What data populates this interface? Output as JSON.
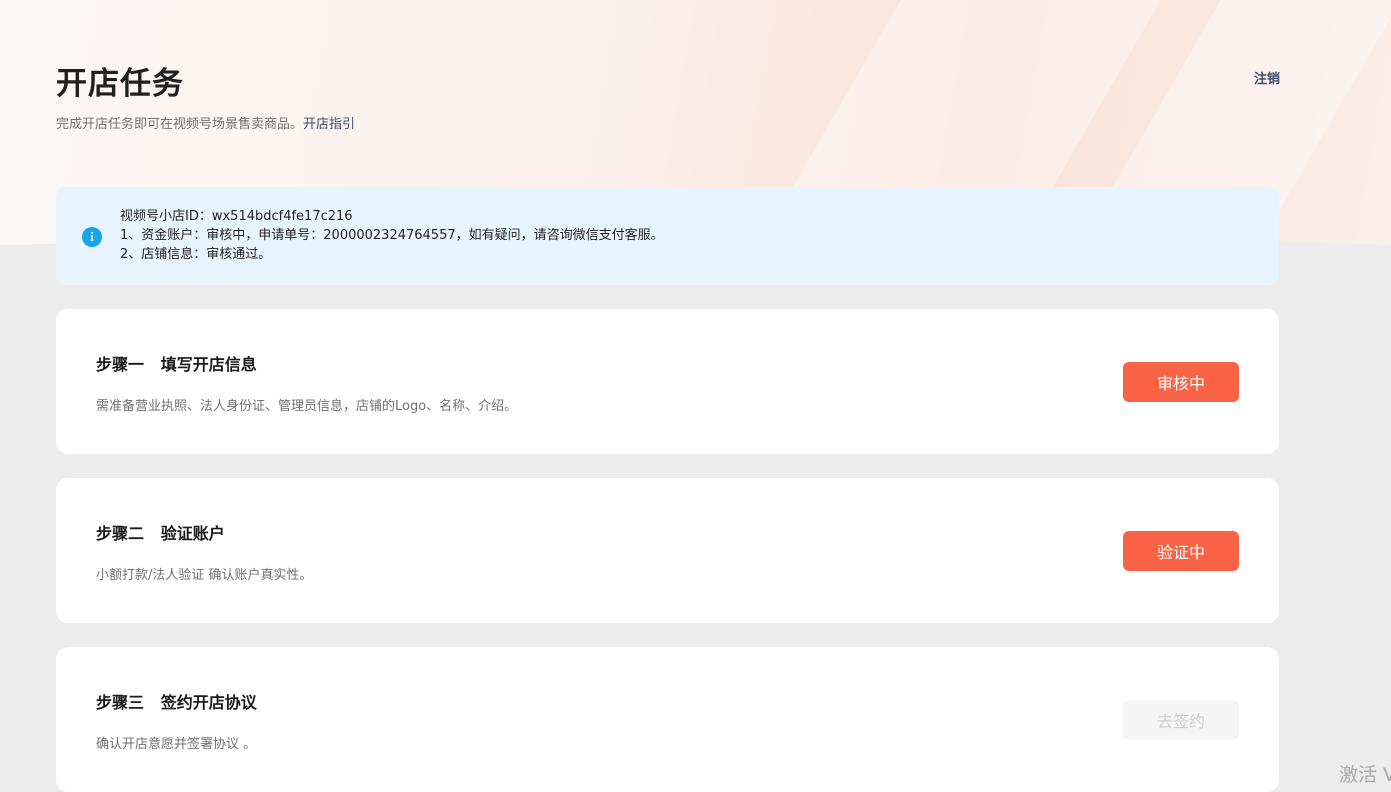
{
  "header": {
    "title": "开店任务",
    "subtitle": "完成开店任务即可在视频号场景售卖商品。",
    "guide_link": "开店指引",
    "logout": "注销"
  },
  "notice": {
    "icon": "info-icon",
    "icon_glyph": "i",
    "line1": "视频号小店ID：wx514bdcf4fe17c216",
    "line2": "1、资金账户：审核中，申请单号：2000002324764557，如有疑问，请咨询微信支付客服。",
    "line3": "2、店铺信息：审核通过。"
  },
  "steps": [
    {
      "title": "步骤一   填写开店信息",
      "desc": "需准备营业执照、法人身份证、管理员信息，店铺的Logo、名称、介绍。",
      "button": "审核中"
    },
    {
      "title": "步骤二   验证账户",
      "desc": "小额打款/法人验证 确认账户真实性。",
      "button": "验证中"
    },
    {
      "title": "步骤三   签约开店协议",
      "desc": "确认开店意愿并签署协议 。",
      "button": "去签约"
    }
  ],
  "watermark": "激活 V",
  "colors": {
    "accent_button": "#fa6245",
    "info_icon": "#15a5ea",
    "notice_bg": "#e8f4fd",
    "link": "#3c4d6d"
  }
}
